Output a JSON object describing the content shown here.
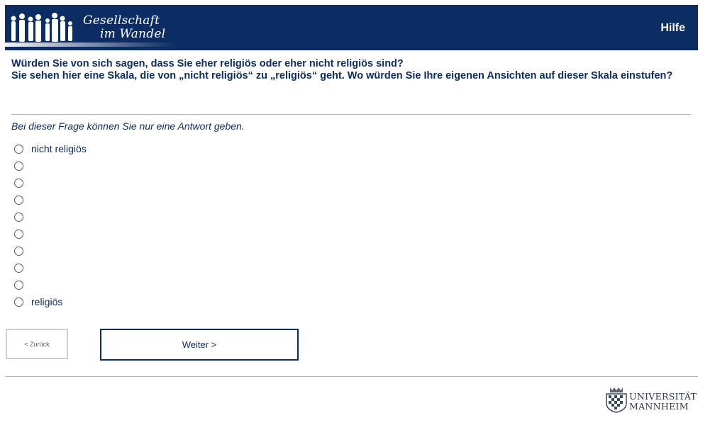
{
  "header": {
    "brand_line1": "Gesellschaft",
    "brand_line2": "im Wandel",
    "help_label": "Hilfe",
    "logo_icon": "people-silhouettes-icon"
  },
  "question": {
    "line1": "Würden Sie von sich sagen, dass Sie eher religiös oder eher nicht religiös sind?",
    "line2": "Sie sehen hier eine Skala, die von „nicht religiös“ zu „religiös“ geht. Wo würden Sie Ihre eigenen Ansichten auf dieser Skala einstufen?"
  },
  "instruction": "Bei dieser Frage können Sie nur eine Antwort geben.",
  "options": [
    {
      "label": "nicht religiös"
    },
    {
      "label": ""
    },
    {
      "label": ""
    },
    {
      "label": ""
    },
    {
      "label": ""
    },
    {
      "label": ""
    },
    {
      "label": ""
    },
    {
      "label": ""
    },
    {
      "label": ""
    },
    {
      "label": "religiös"
    }
  ],
  "buttons": {
    "back_label": "< Zurück",
    "next_label": "Weiter >"
  },
  "footer": {
    "university_line1": "UNIVERSITÄT",
    "university_line2": "MANNHEIM",
    "crest_icon": "university-crest-icon"
  },
  "colors": {
    "brand_blue": "#0c2d63",
    "divider": "#b0b0b0"
  }
}
